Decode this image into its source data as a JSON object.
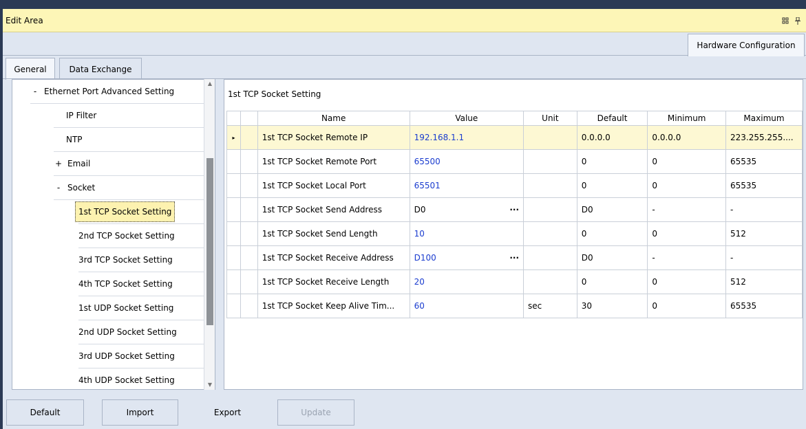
{
  "window": {
    "title": "Edit Area",
    "icons": [
      "restore-icon",
      "pin-icon"
    ]
  },
  "top_tabs": [
    {
      "label": "Hardware Configuration"
    }
  ],
  "sub_tabs": [
    {
      "label": "General",
      "active": true
    },
    {
      "label": "Data Exchange",
      "active": false
    }
  ],
  "tree": {
    "items": [
      {
        "label": "Ethernet Port Advanced Setting",
        "expander": "-"
      },
      {
        "label": "IP Filter",
        "expander": ""
      },
      {
        "label": "NTP",
        "expander": ""
      },
      {
        "label": "Email",
        "expander": "+"
      },
      {
        "label": "Socket",
        "expander": "-"
      },
      {
        "label": "1st TCP Socket Setting",
        "expander": "",
        "selected": true
      },
      {
        "label": "2nd TCP Socket Setting",
        "expander": ""
      },
      {
        "label": "3rd TCP Socket Setting",
        "expander": ""
      },
      {
        "label": "4th TCP Socket Setting",
        "expander": ""
      },
      {
        "label": "1st UDP Socket Setting",
        "expander": ""
      },
      {
        "label": "2nd UDP Socket Setting",
        "expander": ""
      },
      {
        "label": "3rd UDP Socket Setting",
        "expander": ""
      },
      {
        "label": "4th UDP Socket Setting",
        "expander": ""
      }
    ]
  },
  "panel": {
    "title": "1st TCP Socket Setting",
    "columns": [
      "Name",
      "Value",
      "Unit",
      "Default",
      "Minimum",
      "Maximum"
    ],
    "rows": [
      {
        "name": "1st TCP Socket Remote IP",
        "value": "192.168.1.1",
        "unit": "",
        "default": "0.0.0.0",
        "minimum": "0.0.0.0",
        "maximum": "223.255.255....",
        "current": true,
        "ellipsis": false,
        "value_color": "blue"
      },
      {
        "name": "1st TCP Socket Remote Port",
        "value": "65500",
        "unit": "",
        "default": "0",
        "minimum": "0",
        "maximum": "65535",
        "current": false,
        "ellipsis": false,
        "value_color": "blue"
      },
      {
        "name": "1st TCP Socket Local Port",
        "value": "65501",
        "unit": "",
        "default": "0",
        "minimum": "0",
        "maximum": "65535",
        "current": false,
        "ellipsis": false,
        "value_color": "blue"
      },
      {
        "name": "1st TCP Socket Send Address",
        "value": "D0",
        "unit": "",
        "default": "D0",
        "minimum": "-",
        "maximum": "-",
        "current": false,
        "ellipsis": true,
        "value_color": "black"
      },
      {
        "name": "1st TCP Socket Send Length",
        "value": "10",
        "unit": "",
        "default": "0",
        "minimum": "0",
        "maximum": "512",
        "current": false,
        "ellipsis": false,
        "value_color": "blue"
      },
      {
        "name": "1st TCP Socket Receive Address",
        "value": "D100",
        "unit": "",
        "default": "D0",
        "minimum": "-",
        "maximum": "-",
        "current": false,
        "ellipsis": true,
        "value_color": "blue"
      },
      {
        "name": "1st TCP Socket Receive Length",
        "value": "20",
        "unit": "",
        "default": "0",
        "minimum": "0",
        "maximum": "512",
        "current": false,
        "ellipsis": false,
        "value_color": "blue"
      },
      {
        "name": "1st TCP Socket Keep Alive Tim...",
        "value": "60",
        "unit": "sec",
        "default": "30",
        "minimum": "0",
        "maximum": "65535",
        "current": false,
        "ellipsis": false,
        "value_color": "blue"
      }
    ],
    "ellipsis_label": "···",
    "row_indicator": "▸"
  },
  "buttons": {
    "default": "Default",
    "import": "Import",
    "export": "Export",
    "update": "Update"
  }
}
